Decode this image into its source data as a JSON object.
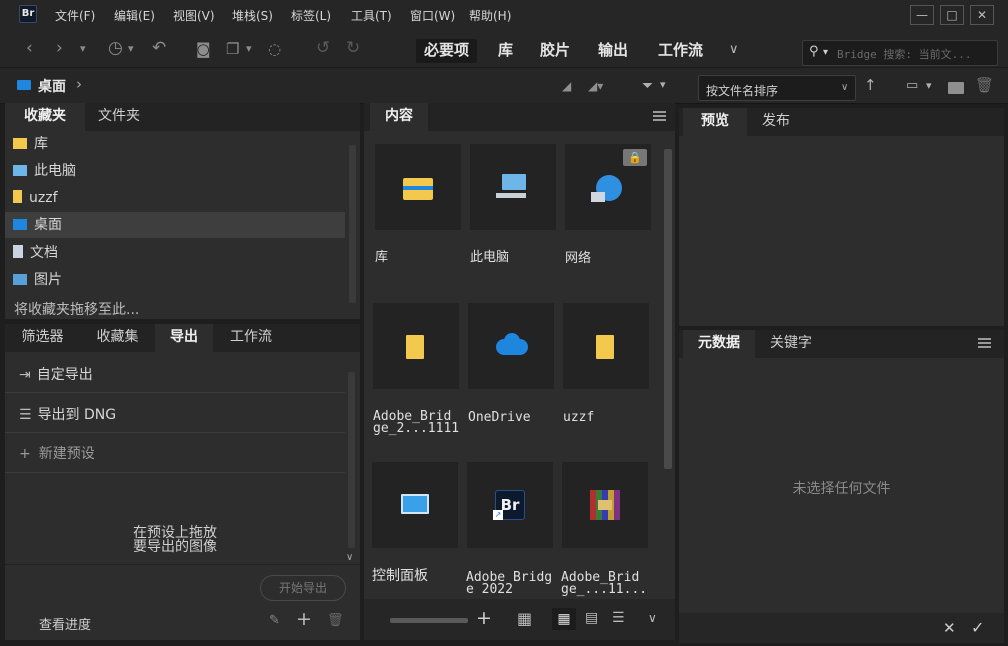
{
  "app": {
    "logo": "Br"
  },
  "menu": [
    "文件(F)",
    "编辑(E)",
    "视图(V)",
    "堆栈(S)",
    "标签(L)",
    "工具(T)",
    "窗口(W)",
    "帮助(H)"
  ],
  "window_controls": [
    "minimize-icon",
    "maximize-icon",
    "close-icon"
  ],
  "workspaces": [
    "必要项",
    "库",
    "胶片",
    "输出",
    "工作流"
  ],
  "search": {
    "placeholder": "Bridge 搜索: 当前文..."
  },
  "path": {
    "current": "桌面",
    "separator": "›"
  },
  "sort": {
    "label": "按文件名排序"
  },
  "left_top_panel": {
    "tabs": [
      "收藏夹",
      "文件夹"
    ],
    "items": [
      {
        "label": "库",
        "icon": "library-folder-icon"
      },
      {
        "label": "此电脑",
        "icon": "computer-icon"
      },
      {
        "label": "uzzf",
        "icon": "folder-icon"
      },
      {
        "label": "桌面",
        "icon": "desktop-icon",
        "selected": true
      },
      {
        "label": "文档",
        "icon": "document-icon"
      },
      {
        "label": "图片",
        "icon": "picture-icon"
      }
    ],
    "drag_hint": "将收藏夹拖移至此..."
  },
  "left_bottom_panel": {
    "tabs": [
      "筛选器",
      "收藏集",
      "导出",
      "工作流"
    ],
    "rows": [
      "自定导出",
      "导出到 DNG",
      "新建预设"
    ],
    "drop_hint_line1": "在预设上拖放",
    "drop_hint_line2": "要导出的图像",
    "start_button": "开始导出",
    "progress_link": "查看进度"
  },
  "content_panel": {
    "tab": "内容",
    "items": [
      {
        "label": "库",
        "icon": "library-folder-icon"
      },
      {
        "label": "此电脑",
        "icon": "computer-icon"
      },
      {
        "label": "网络",
        "icon": "network-icon",
        "locked": true
      },
      {
        "label": "Adobe_Brid\nge_2...1111",
        "icon": "folder-icon"
      },
      {
        "label": "OneDrive",
        "icon": "onedrive-cloud-icon"
      },
      {
        "label": "uzzf",
        "icon": "folder-icon"
      },
      {
        "label": "控制面板",
        "icon": "control-panel-icon"
      },
      {
        "label": "Adobe Bridg\ne 2022",
        "icon": "bridge-shortcut-icon"
      },
      {
        "label": "Adobe_Brid\nge_...11...",
        "icon": "winrar-archive-icon"
      }
    ]
  },
  "preview_panel": {
    "tabs": [
      "预览",
      "发布"
    ]
  },
  "metadata_panel": {
    "tabs": [
      "元数据",
      "关键字"
    ],
    "empty_text": "未选择任何文件"
  },
  "colors": {
    "accent_blue": "#1f86e0",
    "folder_yellow": "#f2c94c",
    "background": "#1e1e1e",
    "panel": "#2d2d2d"
  }
}
